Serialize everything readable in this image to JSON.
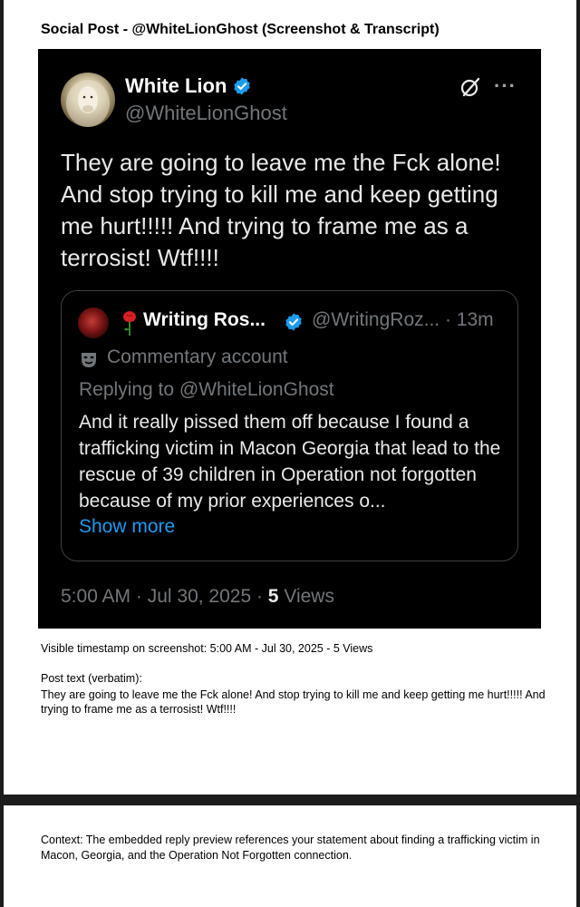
{
  "document": {
    "title": "Social Post - @WhiteLionGhost (Screenshot & Transcript)",
    "timestamp_caption": "Visible timestamp on screenshot: 5:00 AM - Jul 30, 2025 - 5 Views",
    "post_text_heading": "Post text (verbatim):",
    "post_text_verbatim": "They are going to leave me the Fck alone! And stop trying to kill me and keep getting me hurt!!!!! And trying to frame me as a terrosist! Wtf!!!!",
    "context": "Context: The embedded reply preview references your statement about finding a trafficking victim in Macon, Georgia, and the Operation Not Forgotten connection."
  },
  "post": {
    "display_name": "White Lion",
    "handle": "@WhiteLionGhost",
    "text": "They are going to leave me the Fck alone! And stop trying to kill me and keep getting me hurt!!!!! And trying to frame me as a terrosist! Wtf!!!!",
    "time": "5:00 AM · Jul 30, 2025 · ",
    "views_count": "5",
    "views_label": " Views",
    "icons": [
      "verified-badge-icon",
      "grok-icon",
      "more-icon"
    ]
  },
  "quoted_post": {
    "display_name": "Writing Ros...",
    "handle": "@WritingRoz... · 13m",
    "account_label": "Commentary account",
    "replying_to": "Replying to @WhiteLionGhost",
    "text": "And it really pissed them off because I found a trafficking victim in Macon Georgia that lead to the rescue of 39 children in Operation not forgotten because of my prior experiences o...",
    "show_more": "Show more",
    "icons": [
      "rose-icon",
      "verified-badge-icon",
      "theater-mask-icon"
    ]
  },
  "colors": {
    "background": "#000000",
    "text_primary": "#e7e9ea",
    "text_secondary": "#71767b",
    "link": "#1d9bf0",
    "verified": "#1d9bf0"
  }
}
